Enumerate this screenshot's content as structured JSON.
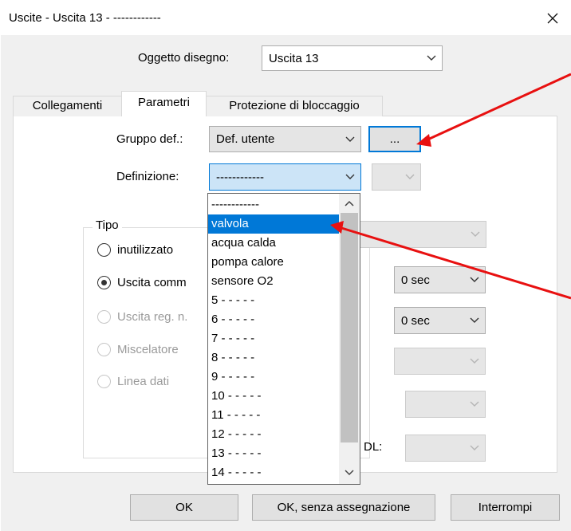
{
  "window": {
    "title": "Uscite - Uscita 13 - ------------"
  },
  "header": {
    "oggetto_label": "Oggetto disegno:",
    "oggetto_value": "Uscita 13"
  },
  "tabs": [
    {
      "label": "Collegamenti"
    },
    {
      "label": "Parametri"
    },
    {
      "label": "Protezione di bloccaggio"
    }
  ],
  "params": {
    "gruppo_label": "Gruppo def.:",
    "gruppo_value": "Def. utente",
    "ellipsis_label": "...",
    "definizione_label": "Definizione:",
    "definizione_value": "------------"
  },
  "tipo": {
    "title": "Tipo",
    "options": [
      {
        "label": "inutilizzato",
        "selected": false,
        "enabled": true
      },
      {
        "label": "Uscita comm",
        "selected": true,
        "enabled": true
      },
      {
        "label": "Uscita reg. n.",
        "selected": false,
        "enabled": false
      },
      {
        "label": "Miscelatore",
        "selected": false,
        "enabled": false
      },
      {
        "label": "Linea dati",
        "selected": false,
        "enabled": false
      }
    ]
  },
  "right_controls": {
    "time1": "0 sec",
    "time2": "0 sec",
    "dl_label": "DL:"
  },
  "dropdown": {
    "items": [
      "------------",
      "valvola",
      "acqua calda",
      "pompa calore",
      "sensore O2",
      " 5 - - - - -",
      " 6 - - - - -",
      " 7 - - - - -",
      " 8 - - - - -",
      " 9 - - - - -",
      "10 - - - - -",
      "11 - - - - -",
      "12 - - - - -",
      "13 - - - - -",
      "14 - - - - -"
    ],
    "selected_index": 1
  },
  "buttons": {
    "ok": "OK",
    "ok_no_assign": "OK, senza assegnazione",
    "cancel": "Interrompi"
  },
  "colors": {
    "accent": "#0078d7",
    "annotation_arrow": "#e81010",
    "selection": "#0078d7"
  }
}
